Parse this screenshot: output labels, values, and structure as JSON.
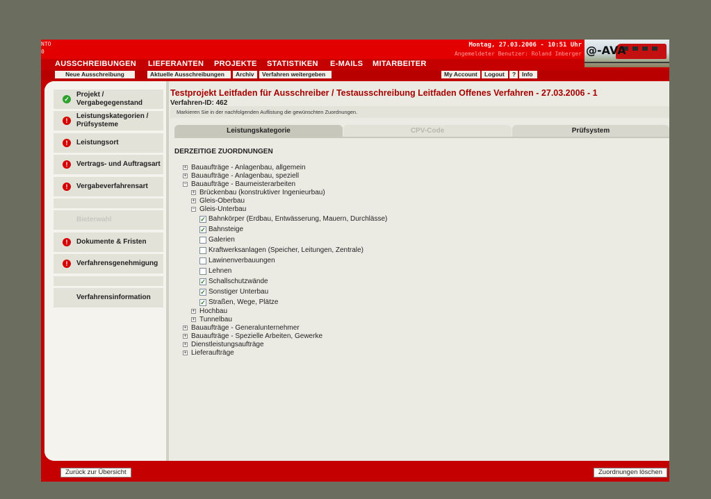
{
  "header": {
    "corner_line1": "NTO",
    "corner_line2": "0",
    "date": "Montag, 27.03.2006 - 10:51 Uhr",
    "user": "Angemeldeter Benutzer: Roland Imberger",
    "logo": "@-AVA"
  },
  "main_nav": [
    "AUSSCHREIBUNGEN",
    "LIEFERANTEN",
    "PROJEKTE",
    "STATISTIKEN",
    "E-MAILS",
    "MITARBEITER"
  ],
  "sub_nav": {
    "left": [
      "Neue Ausschreibung",
      "Aktuelle Ausschreibungen",
      "Archiv",
      "Verfahren weitergeben"
    ],
    "right": [
      "My Account",
      "Logout",
      "?",
      "Info"
    ]
  },
  "sidebar": {
    "items": [
      {
        "label": "Projekt / Vergabegegenstand",
        "status": "ok"
      },
      {
        "label": "Leistungskategorien / Prüfsysteme",
        "status": "error"
      },
      {
        "label": "Leistungsort",
        "status": "error"
      },
      {
        "label": "Vertrags- und Auftragsart",
        "status": "error"
      },
      {
        "label": "Vergabeverfahrensart",
        "status": "error"
      },
      {
        "label": "",
        "status": "none"
      },
      {
        "label": "Bieterwahl",
        "status": "disabled"
      },
      {
        "label": "Dokumente & Fristen",
        "status": "error"
      },
      {
        "label": "Verfahrensgenehmigung",
        "status": "error"
      },
      {
        "label": "",
        "status": "none"
      },
      {
        "label": "Verfahrensinformation",
        "status": "none"
      }
    ]
  },
  "page": {
    "title": "Testprojekt Leitfaden für Ausschreiber / Testausschreibung Leitfaden Offenes Verfahren - 27.03.2006 - 1",
    "verfahren_id": "Verfahren-ID: 462",
    "instruction": "Markieren Sie in der nachfolgenden Auflistung die gewünschten Zuordnungen.",
    "section_heading": "DERZEITIGE ZUORDNUNGEN"
  },
  "tabs": [
    {
      "label": "Leistungskategorie",
      "state": "active"
    },
    {
      "label": "CPV-Code",
      "state": "disabled"
    },
    {
      "label": "Prüfsystem",
      "state": "normal"
    }
  ],
  "tree": [
    {
      "label": "Bauaufträge - Anlagenbau, allgemein",
      "level": 0,
      "type": "expand",
      "sign": "+"
    },
    {
      "label": "Bauaufträge - Anlagenbau, speziell",
      "level": 0,
      "type": "expand",
      "sign": "+"
    },
    {
      "label": "Bauaufträge - Baumeisterarbeiten",
      "level": 0,
      "type": "expand",
      "sign": "−"
    },
    {
      "label": "Brückenbau (konstruktiver Ingenieurbau)",
      "level": 1,
      "type": "expand",
      "sign": "+"
    },
    {
      "label": "Gleis-Oberbau",
      "level": 1,
      "type": "expand",
      "sign": "+"
    },
    {
      "label": "Gleis-Unterbau",
      "level": 1,
      "type": "expand",
      "sign": "−"
    },
    {
      "label": "Bahnkörper (Erdbau, Entwässerung, Mauern, Durchlässe)",
      "level": 2,
      "type": "check",
      "checked": true
    },
    {
      "label": "Bahnsteige",
      "level": 2,
      "type": "check",
      "checked": true
    },
    {
      "label": "Galerien",
      "level": 2,
      "type": "check",
      "checked": false
    },
    {
      "label": "Kraftwerksanlagen (Speicher, Leitungen, Zentrale)",
      "level": 2,
      "type": "check",
      "checked": false
    },
    {
      "label": "Lawinenverbauungen",
      "level": 2,
      "type": "check",
      "checked": false
    },
    {
      "label": "Lehnen",
      "level": 2,
      "type": "check",
      "checked": false
    },
    {
      "label": "Schallschutzwände",
      "level": 2,
      "type": "check",
      "checked": true
    },
    {
      "label": "Sonstiger Unterbau",
      "level": 2,
      "type": "check",
      "checked": true
    },
    {
      "label": "Straßen, Wege, Plätze",
      "level": 2,
      "type": "check",
      "checked": true
    },
    {
      "label": "Hochbau",
      "level": 1,
      "type": "expand",
      "sign": "+"
    },
    {
      "label": "Tunnelbau",
      "level": 1,
      "type": "expand",
      "sign": "+"
    },
    {
      "label": "Bauaufträge - Generalunternehmer",
      "level": 0,
      "type": "expand",
      "sign": "+"
    },
    {
      "label": "Bauaufträge - Spezielle Arbeiten, Gewerke",
      "level": 0,
      "type": "expand",
      "sign": "+"
    },
    {
      "label": "Dienstleistungsaufträge",
      "level": 0,
      "type": "expand",
      "sign": "+"
    },
    {
      "label": "Lieferaufträge",
      "level": 0,
      "type": "expand",
      "sign": "+"
    }
  ],
  "footer": {
    "back": "Zurück zur Übersicht",
    "clear": "Zuordnungen löschen"
  }
}
